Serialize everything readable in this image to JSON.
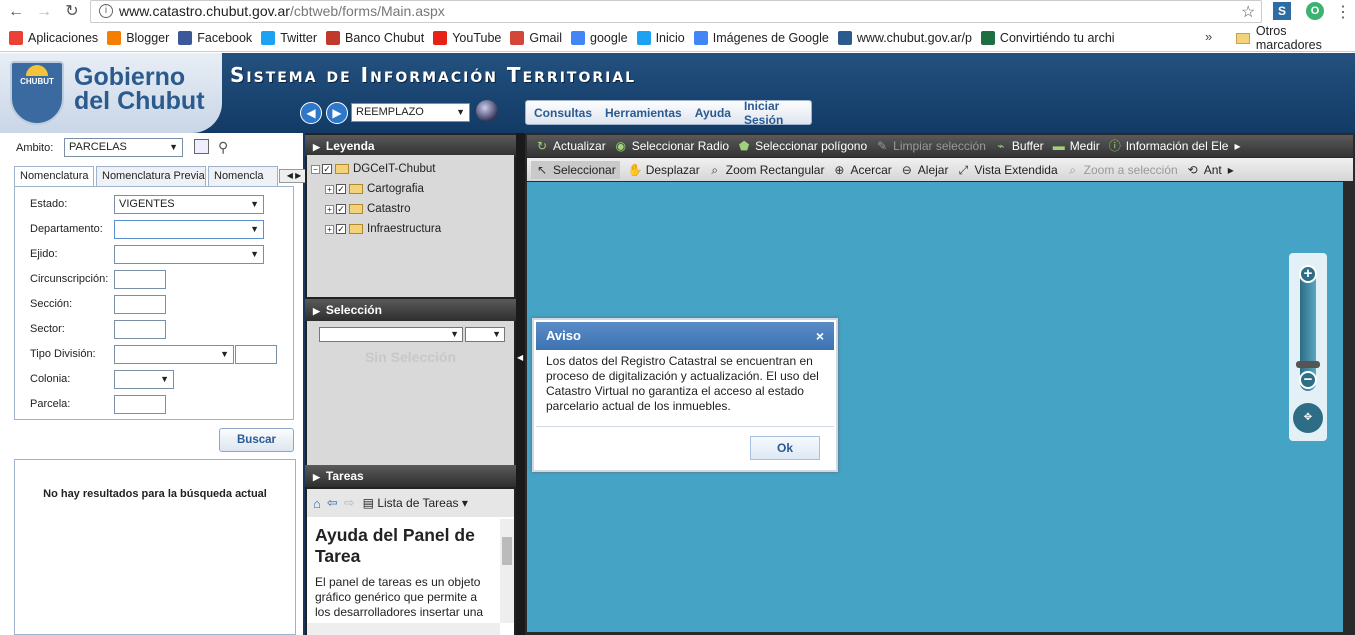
{
  "browser": {
    "url_host": "www.catastro.chubut.gov.ar",
    "url_path": "/cbtweb/forms/Main.aspx",
    "bookmarks": [
      {
        "label": "Aplicaciones",
        "icon": "apps-grid-icon",
        "color": "#e94235"
      },
      {
        "label": "Blogger",
        "icon": "blogger-icon",
        "color": "#f57d00"
      },
      {
        "label": "Facebook",
        "icon": "facebook-icon",
        "color": "#3b5998"
      },
      {
        "label": "Twitter",
        "icon": "twitter-icon",
        "color": "#1da1f2"
      },
      {
        "label": "Banco Chubut",
        "icon": "banco-chubut-icon",
        "color": "#c0392b"
      },
      {
        "label": "YouTube",
        "icon": "youtube-icon",
        "color": "#e62117"
      },
      {
        "label": "Gmail",
        "icon": "gmail-icon",
        "color": "#d44638"
      },
      {
        "label": "google",
        "icon": "google-icon",
        "color": "#4285f4"
      },
      {
        "label": "Inicio",
        "icon": "twitter-icon",
        "color": "#1da1f2"
      },
      {
        "label": "Imágenes de Google",
        "icon": "google-icon",
        "color": "#4285f4"
      },
      {
        "label": "www.chubut.gov.ar/p",
        "icon": "chubut-shield-icon",
        "color": "#2b5b8e"
      },
      {
        "label": "Convirtiéndo tu archi",
        "icon": "excel-icon",
        "color": "#1d6f42"
      }
    ],
    "more": "»",
    "other_bookmarks": "Otros marcadores"
  },
  "header": {
    "logo_line1": "Gobierno",
    "logo_line2": "del Chubut",
    "shield_label": "CHUBUT",
    "system_title": "Sistema de Información Territorial",
    "mode_value": "REEMPLAZO",
    "menu": [
      "Consultas",
      "Herramientas",
      "Ayuda",
      "Iniciar Sesión"
    ]
  },
  "left": {
    "ambito_label": "Ambito:",
    "ambito_value": "PARCELAS",
    "tabs": [
      "Nomenclatura",
      "Nomenclatura Previa",
      "Nomencla"
    ],
    "fields": [
      {
        "label": "Estado:",
        "value": "VIGENTES"
      },
      {
        "label": "Departamento:",
        "value": ""
      },
      {
        "label": "Ejido:",
        "value": ""
      },
      {
        "label": "Circunscripción:",
        "value": ""
      },
      {
        "label": "Sección:",
        "value": ""
      },
      {
        "label": "Sector:",
        "value": ""
      },
      {
        "label": "Tipo División:",
        "value": ""
      },
      {
        "label": "Colonia:",
        "value": ""
      },
      {
        "label": "Parcela:",
        "value": ""
      }
    ],
    "search_button": "Buscar",
    "no_results": "No hay resultados para la búsqueda actual"
  },
  "middle": {
    "legend_title": "Leyenda",
    "tree": [
      "DGCeIT-Chubut",
      "Cartografia",
      "Catastro",
      "Infraestructura"
    ],
    "selection_title": "Selección",
    "no_selection": "Sin Selección",
    "tasks_title": "Tareas",
    "task_list": "Lista de Tareas",
    "help_title": "Ayuda del Panel de Tarea",
    "help_text": "El panel de tareas es un objeto gráfico genérico que permite a los desarrolladores insertar una"
  },
  "map": {
    "toolbar1": [
      {
        "label": "Actualizar",
        "icon": "refresh-icon",
        "disabled": false
      },
      {
        "label": "Seleccionar Radio",
        "icon": "select-radius-icon",
        "disabled": false
      },
      {
        "label": "Seleccionar polígono",
        "icon": "select-polygon-icon",
        "disabled": false
      },
      {
        "label": "Limpiar selección",
        "icon": "clear-selection-icon",
        "disabled": true
      },
      {
        "label": "Buffer",
        "icon": "buffer-icon",
        "disabled": false
      },
      {
        "label": "Medir",
        "icon": "measure-icon",
        "disabled": false
      },
      {
        "label": "Información del Ele",
        "icon": "info-element-icon",
        "disabled": false
      }
    ],
    "toolbar2": [
      {
        "label": "Seleccionar",
        "icon": "select-arrow-icon",
        "disabled": false,
        "active": true
      },
      {
        "label": "Desplazar",
        "icon": "pan-hand-icon",
        "disabled": false
      },
      {
        "label": "Zoom Rectangular",
        "icon": "zoom-rect-icon",
        "disabled": false
      },
      {
        "label": "Acercar",
        "icon": "zoom-in-icon",
        "disabled": false
      },
      {
        "label": "Alejar",
        "icon": "zoom-out-icon",
        "disabled": false
      },
      {
        "label": "Vista Extendida",
        "icon": "extent-icon",
        "disabled": false
      },
      {
        "label": "Zoom a selección",
        "icon": "zoom-selection-icon",
        "disabled": true
      },
      {
        "label": "Ant",
        "icon": "previous-view-icon",
        "disabled": false
      }
    ],
    "background_color": "#45a3c6"
  },
  "dialog": {
    "title": "Aviso",
    "close": "×",
    "text": "Los datos del Registro Catastral se encuentran en proceso de digitalización y actualización. El uso del Catastro Virtual no garantiza el acceso al estado parcelario actual de los inmuebles.",
    "ok": "Ok"
  }
}
